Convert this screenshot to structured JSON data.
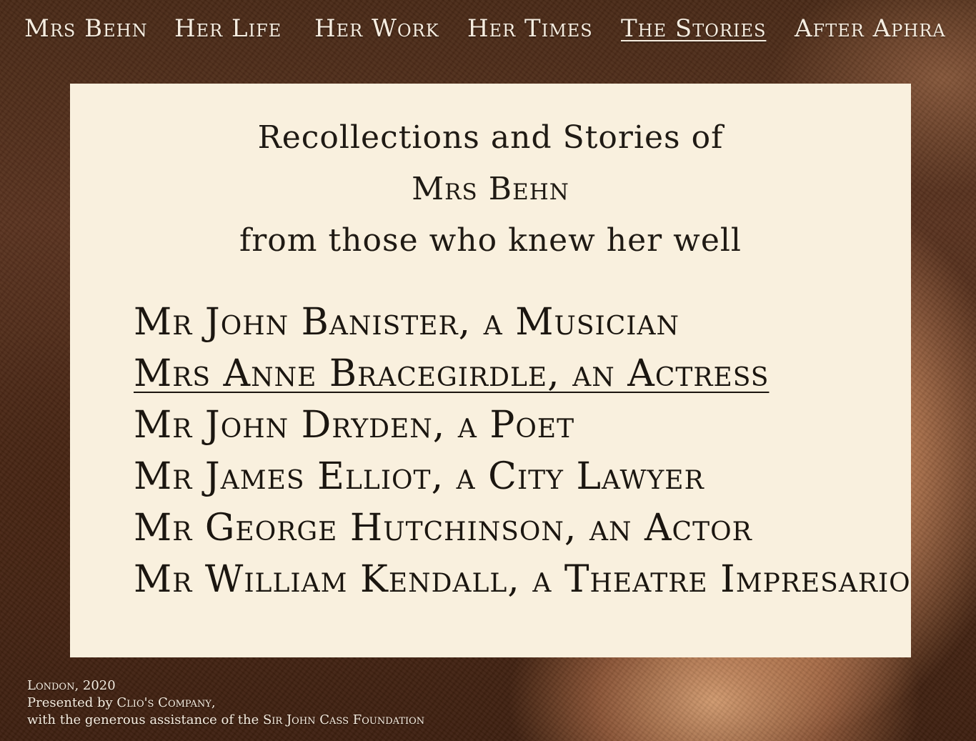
{
  "nav": {
    "items": [
      {
        "label": "Mrs Behn"
      },
      {
        "label": "Her Life"
      },
      {
        "label": "Her Work"
      },
      {
        "label": "Her Times"
      },
      {
        "label": "The Stories",
        "active": true
      },
      {
        "label": "After Aphra"
      }
    ]
  },
  "panel": {
    "heading_line1": "Recollections and Stories of",
    "heading_line2": "Mrs Behn",
    "heading_line3": "from those who knew her well",
    "stories": [
      {
        "label": "Mr John Banister, a Musician"
      },
      {
        "label": "Mrs Anne Bracegirdle, an Actress",
        "underlined": true
      },
      {
        "label": "Mr John Dryden, a Poet"
      },
      {
        "label": "Mr James Elliot, a City Lawyer"
      },
      {
        "label": "Mr George Hutchinson, an Actor"
      },
      {
        "label": "Mr William Kendall, a Theatre Impresario"
      }
    ]
  },
  "footer": {
    "line1": "London, 2020",
    "line2_prefix": "Presented by ",
    "line2_company": "Clio's Company,",
    "line3_prefix": "with the generous assistance of the ",
    "line3_foundation": "Sir John Cass Foundation"
  },
  "colors": {
    "panel_background": "#f9f0de",
    "nav_text": "#f6ede0",
    "panel_text": "#1b1610"
  }
}
